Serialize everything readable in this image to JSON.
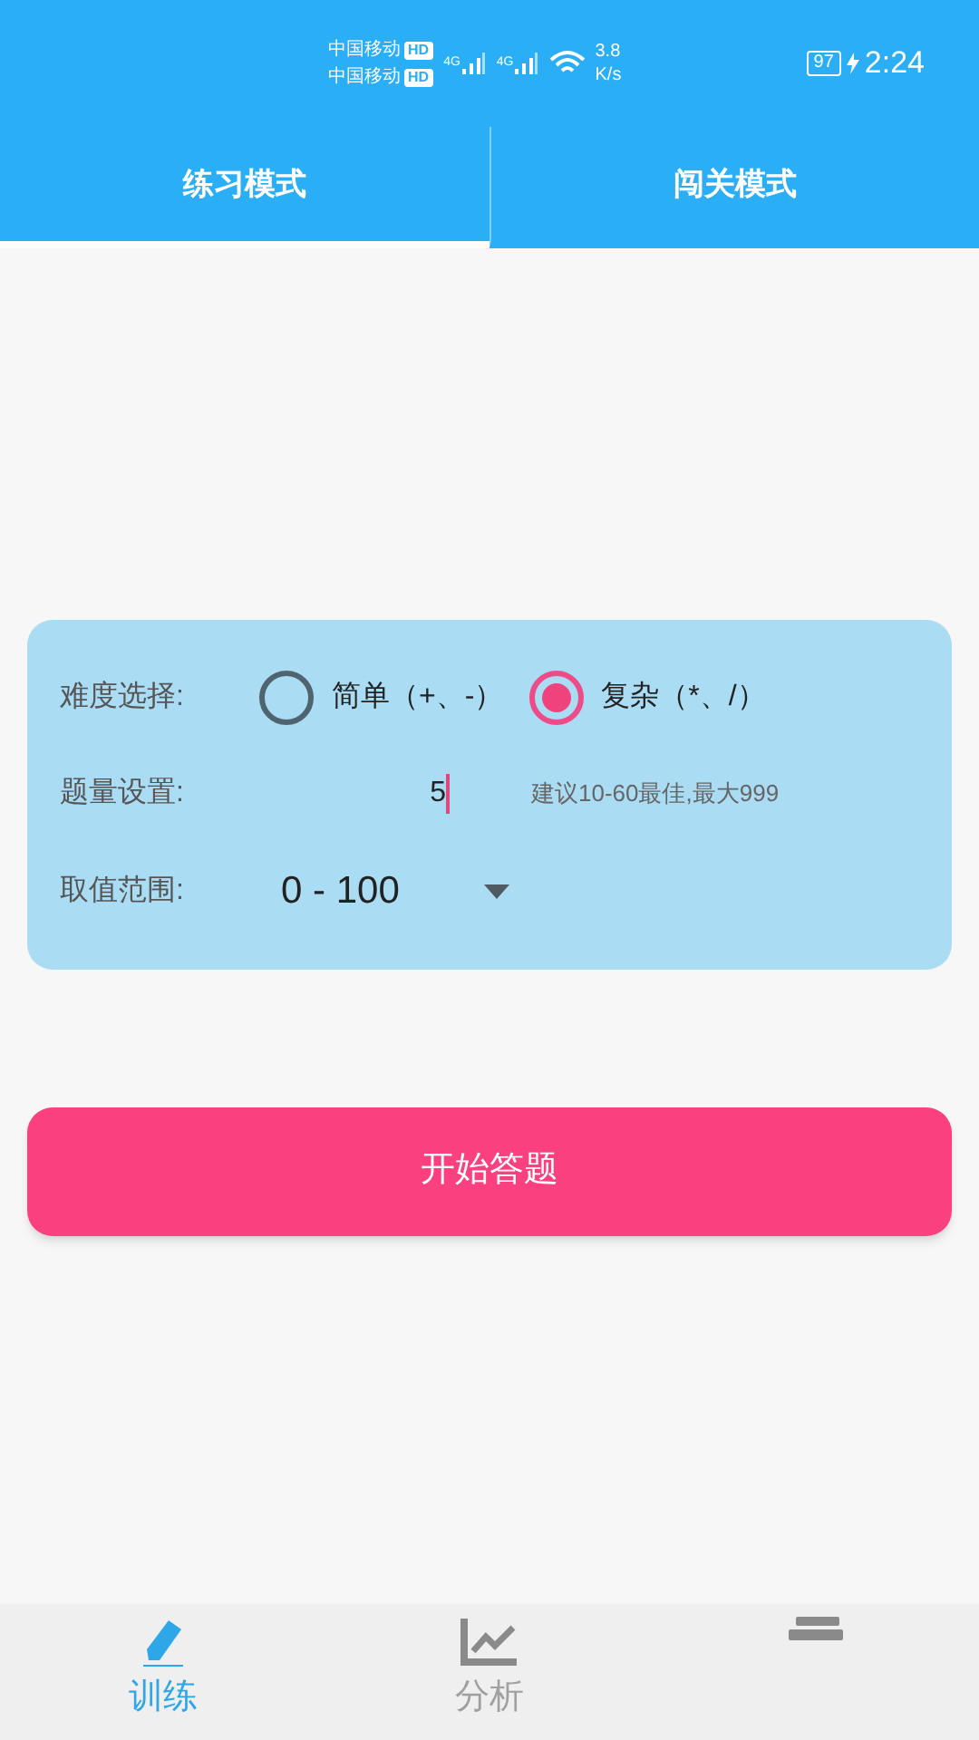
{
  "status_bar": {
    "carriers": [
      {
        "name": "中国移动",
        "badge": "HD"
      },
      {
        "name": "中国移动",
        "badge": "HD"
      }
    ],
    "signals": [
      "4G",
      "4G"
    ],
    "speed": [
      "3.8",
      "K/s"
    ],
    "battery": "97",
    "time": "2:24"
  },
  "tabs": [
    {
      "label": "练习模式",
      "selected": true
    },
    {
      "label": "闯关模式",
      "selected": false
    }
  ],
  "settings": {
    "difficulty": {
      "label": "难度选择:",
      "options": [
        {
          "label": "简单（+、-）",
          "selected": false
        },
        {
          "label": "复杂（*、/）",
          "selected": true
        }
      ]
    },
    "count": {
      "label": "题量设置:",
      "value": "5",
      "hint": "建议10-60最佳,最大999"
    },
    "range": {
      "label": "取值范围:",
      "value": "0 - 100"
    }
  },
  "start_button": "开始答题",
  "bottom_nav": [
    {
      "kind": "pencil",
      "label": "训练",
      "selected": true
    },
    {
      "kind": "chart",
      "label": "分析",
      "selected": false
    },
    {
      "kind": "cards",
      "selected": false
    }
  ]
}
